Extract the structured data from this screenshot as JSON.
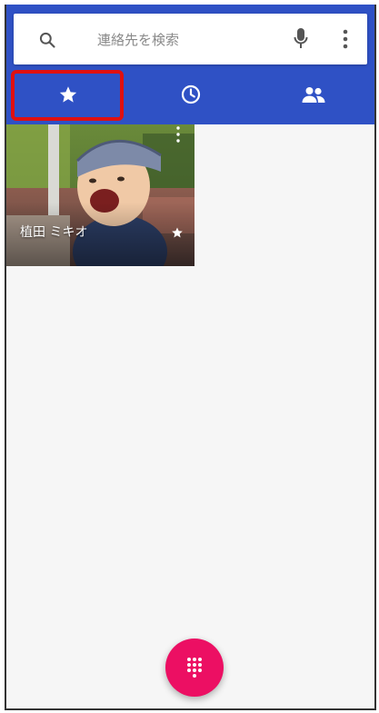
{
  "search": {
    "placeholder": "連絡先を検索"
  },
  "tabs": [
    {
      "name": "favorites",
      "icon": "star-icon",
      "selected": true
    },
    {
      "name": "recents",
      "icon": "clock-icon",
      "selected": false
    },
    {
      "name": "contacts",
      "icon": "people-icon",
      "selected": false
    }
  ],
  "favorites": [
    {
      "name": "植田 ミキオ",
      "starred": true
    }
  ],
  "colors": {
    "appbar": "#2f51c5",
    "fab": "#ec0f63",
    "highlight": "#e01010"
  }
}
